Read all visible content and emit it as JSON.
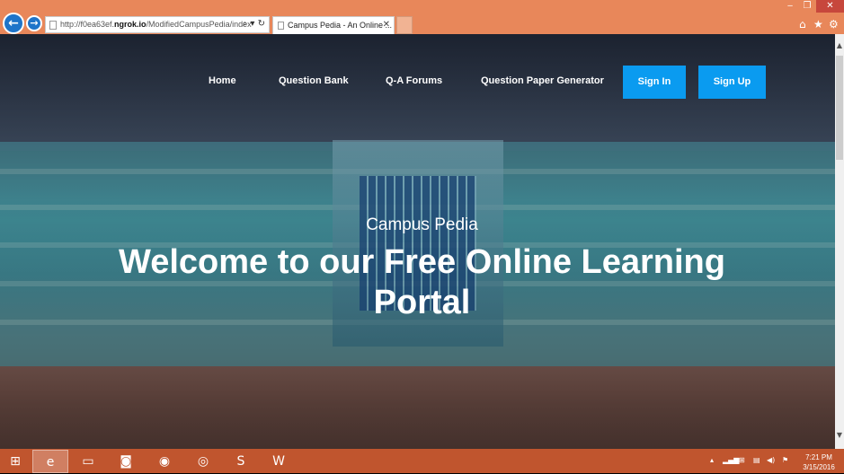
{
  "browser": {
    "url_prefix": "http://f0ea63ef.",
    "url_domain": "ngrok.io",
    "url_suffix": "/ModifiedCampusPedia/index",
    "tab_title": "Campus Pedia - An Online ...",
    "close_glyph": "✕"
  },
  "site": {
    "nav": [
      "Home",
      "Question Bank",
      "Q-A Forums",
      "Question Paper Generator"
    ],
    "sign_in": "Sign In",
    "sign_up": "Sign Up",
    "brand": "Campus Pedia",
    "headline": "Welcome to our Free Online Learning Portal"
  },
  "taskbar": {
    "time": "7:21 PM",
    "date": "3/15/2016"
  },
  "colors": {
    "chrome": "#e8875a",
    "taskbar": "#c0552e",
    "button": "#0a9bf0"
  }
}
